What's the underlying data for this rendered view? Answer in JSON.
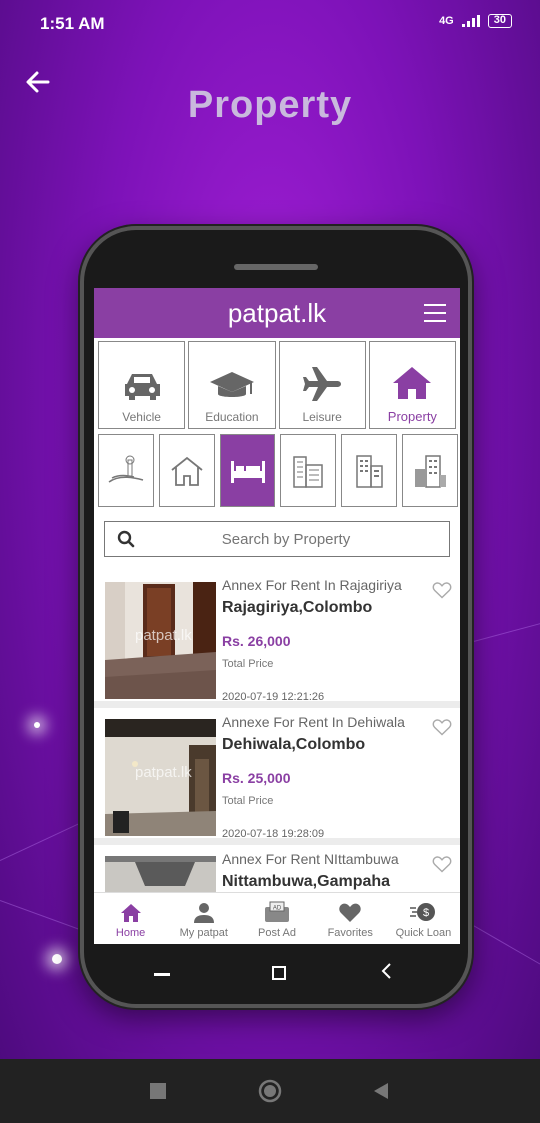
{
  "status": {
    "time": "1:51 AM",
    "signal": "4G",
    "battery": "30"
  },
  "header": {
    "title": "Property",
    "back_icon": "arrow-left-icon"
  },
  "app": {
    "brand": "patpat.lk",
    "categories": [
      {
        "label": "Vehicle",
        "icon": "car-icon"
      },
      {
        "label": "Education",
        "icon": "graduation-cap-icon"
      },
      {
        "label": "Leisure",
        "icon": "airplane-icon"
      },
      {
        "label": "Property",
        "icon": "house-icon",
        "active": true
      }
    ],
    "subcategories": [
      {
        "icon": "land-icon"
      },
      {
        "icon": "house-outline-icon"
      },
      {
        "icon": "bed-icon",
        "active": true
      },
      {
        "icon": "apartment-icon"
      },
      {
        "icon": "building-icon"
      },
      {
        "icon": "commercial-icon"
      }
    ],
    "search": {
      "placeholder": "Search by Property"
    },
    "listings": [
      {
        "title": "Annex For Rent In Rajagiriya",
        "location": "Rajagiriya,Colombo",
        "price": "Rs. 26,000",
        "price_label": "Total Price",
        "date": "2020-07-19 12:21:26",
        "watermark": "patpat.lk"
      },
      {
        "title": "Annexe For Rent In Dehiwala",
        "location": "Dehiwala,Colombo",
        "price": "Rs. 25,000",
        "price_label": "Total Price",
        "date": "2020-07-18 19:28:09",
        "watermark": "patpat.lk"
      },
      {
        "title": "Annex For Rent NIttambuwa",
        "location": "Nittambuwa,Gampaha"
      }
    ],
    "nav": [
      {
        "label": "Home",
        "icon": "home-icon",
        "active": true
      },
      {
        "label": "My patpat",
        "icon": "user-icon"
      },
      {
        "label": "Post Ad",
        "icon": "post-ad-icon",
        "badge": "AD"
      },
      {
        "label": "Favorites",
        "icon": "heart-icon"
      },
      {
        "label": "Quick Loan",
        "icon": "loan-icon"
      }
    ]
  },
  "colors": {
    "accent": "#8a3fa3",
    "background": "#7d12b8"
  }
}
